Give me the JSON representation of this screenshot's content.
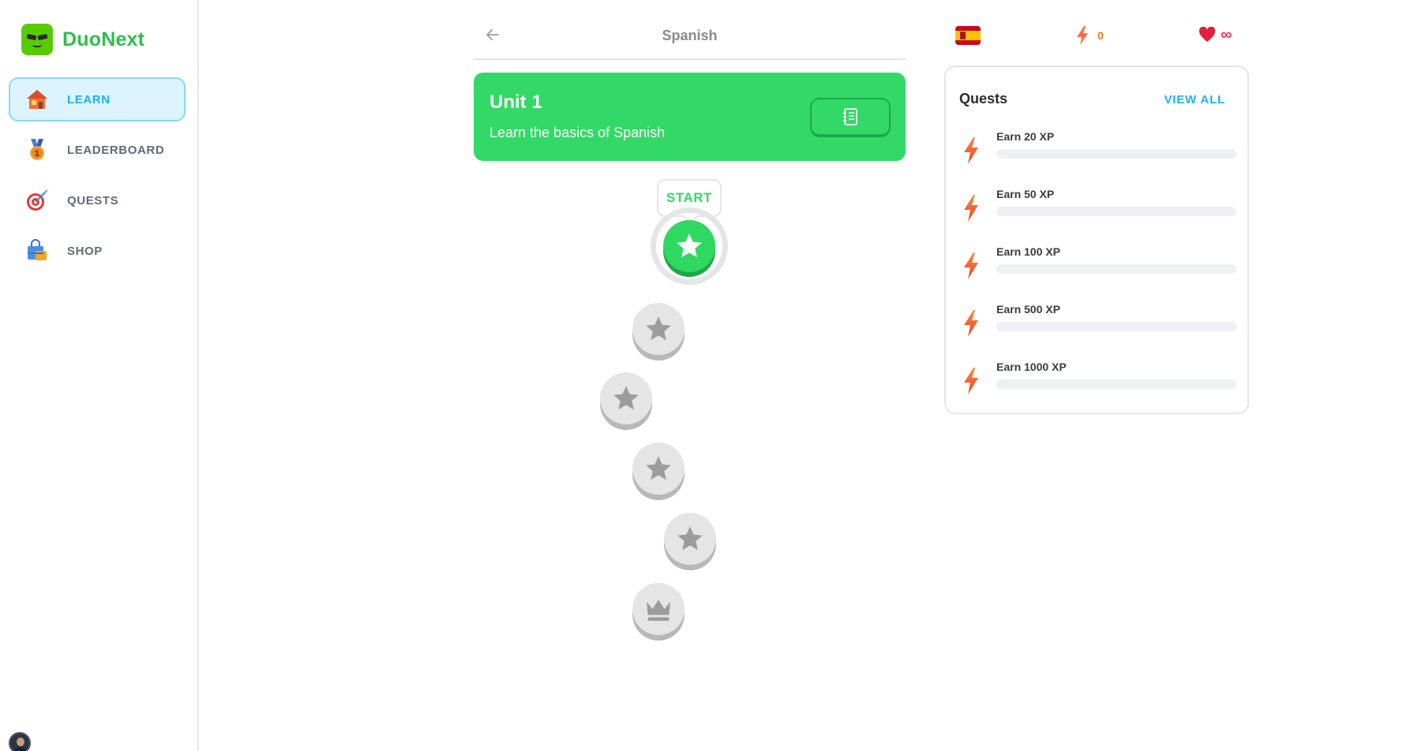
{
  "app": {
    "name": "DuoNext"
  },
  "sidebar": {
    "items": [
      {
        "label": "LEARN",
        "icon": "house-icon",
        "active": true
      },
      {
        "label": "LEADERBOARD",
        "icon": "medal-icon",
        "active": false
      },
      {
        "label": "QUESTS",
        "icon": "target-icon",
        "active": false
      },
      {
        "label": "SHOP",
        "icon": "shopping-bag-icon",
        "active": false
      }
    ]
  },
  "header": {
    "course": "Spanish",
    "back_icon": "arrow-left-icon"
  },
  "unit": {
    "title": "Unit 1",
    "subtitle": "Learn the basics of Spanish",
    "guide_icon": "notebook-icon"
  },
  "path": {
    "start_label": "START",
    "lessons": [
      {
        "status": "active",
        "icon": "star-icon"
      },
      {
        "status": "locked",
        "icon": "star-icon"
      },
      {
        "status": "locked",
        "icon": "star-icon"
      },
      {
        "status": "locked",
        "icon": "star-icon"
      },
      {
        "status": "locked",
        "icon": "star-icon"
      },
      {
        "status": "locked",
        "icon": "crown-icon"
      }
    ]
  },
  "stats": {
    "flag": "spain-flag-icon",
    "xp": "0",
    "hearts": "∞"
  },
  "quests": {
    "title": "Quests",
    "view_all": "VIEW ALL",
    "items": [
      {
        "label": "Earn 20 XP",
        "progress": 0
      },
      {
        "label": "Earn 50 XP",
        "progress": 0
      },
      {
        "label": "Earn 100 XP",
        "progress": 0
      },
      {
        "label": "Earn 500 XP",
        "progress": 0
      },
      {
        "label": "Earn 1000 XP",
        "progress": 0
      }
    ]
  },
  "colors": {
    "brand_green": "#32d966",
    "accent_blue": "#1cb0f6",
    "xp_orange": "#e87a1b",
    "heart_red": "#ff2e54",
    "locked_gray": "#e5e5e5"
  }
}
